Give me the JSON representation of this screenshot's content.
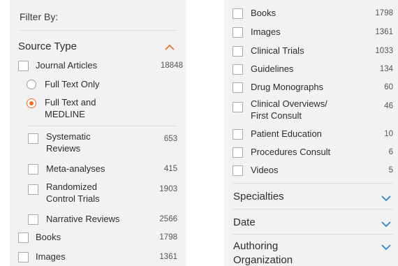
{
  "left": {
    "filter_by": "Filter By:",
    "source_type": "Source Type",
    "journal_articles": {
      "label": "Journal Articles",
      "count": "18848"
    },
    "full_text_only": "Full Text Only",
    "full_text_medline_l1": "Full Text and",
    "full_text_medline_l2": "MEDLINE",
    "systematic": {
      "l1": "Systematic",
      "l2": "Reviews",
      "count": "653"
    },
    "meta": {
      "label": "Meta-analyses",
      "count": "415"
    },
    "rct": {
      "l1": "Randomized",
      "l2": "Control Trials",
      "count": "1903"
    },
    "narrative": {
      "label": "Narrative Reviews",
      "count": "2566"
    },
    "books": {
      "label": "Books",
      "count": "1798"
    },
    "images": {
      "label": "Images",
      "count": "1361"
    }
  },
  "right": {
    "books": {
      "label": "Books",
      "count": "1798"
    },
    "images": {
      "label": "Images",
      "count": "1361"
    },
    "clinical_trials": {
      "label": "Clinical Trials",
      "count": "1033"
    },
    "guidelines": {
      "label": "Guidelines",
      "count": "134"
    },
    "drug_monographs": {
      "label": "Drug Monographs",
      "count": "60"
    },
    "clinical_overviews": {
      "l1": "Clinical Overviews/",
      "l2": "First Consult",
      "count": "46"
    },
    "patient_education": {
      "label": "Patient Education",
      "count": "10"
    },
    "procedures_consult": {
      "label": "Procedures Consult",
      "count": "6"
    },
    "videos": {
      "label": "Videos",
      "count": "5"
    },
    "specialties": "Specialties",
    "date": "Date",
    "authoring_l1": "Authoring",
    "authoring_l2": "Organization"
  },
  "colors": {
    "accent_orange": "#e8702a",
    "chevron_blue": "#2f86c9",
    "panel_bg": "#f2f2f2"
  },
  "icons": {
    "expanded": "chevron-up-icon",
    "collapsed": "chevron-down-icon"
  }
}
